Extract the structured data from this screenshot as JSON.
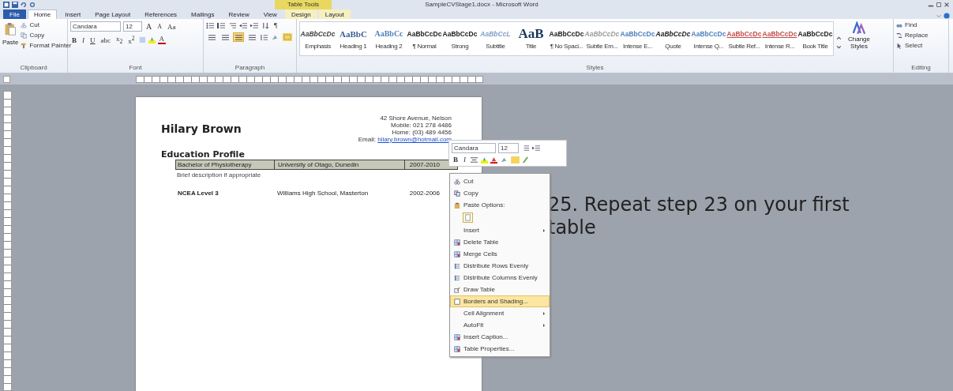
{
  "window": {
    "title": "SampleCVStage1.docx - Microsoft Word",
    "contextual_group": "Table Tools"
  },
  "tabs": [
    {
      "label": "File",
      "kind": "file",
      "selected": false
    },
    {
      "label": "Home",
      "kind": "tab",
      "selected": true
    },
    {
      "label": "Insert",
      "kind": "tab",
      "selected": false
    },
    {
      "label": "Page Layout",
      "kind": "tab",
      "selected": false
    },
    {
      "label": "References",
      "kind": "tab",
      "selected": false
    },
    {
      "label": "Mailings",
      "kind": "tab",
      "selected": false
    },
    {
      "label": "Review",
      "kind": "tab",
      "selected": false
    },
    {
      "label": "View",
      "kind": "tab",
      "selected": false
    },
    {
      "label": "Design",
      "kind": "contextual",
      "selected": false
    },
    {
      "label": "Layout",
      "kind": "contextual",
      "selected": false
    }
  ],
  "clipboard": {
    "paste": "Paste",
    "cut": "Cut",
    "copy": "Copy",
    "format_painter": "Format Painter",
    "group_label": "Clipboard"
  },
  "font": {
    "name": "Candara",
    "size": "12",
    "group_label": "Font",
    "row1": [
      {
        "label": "A",
        "kind": "grow"
      },
      {
        "label": "A",
        "kind": "shrink"
      },
      {
        "label": "Aa",
        "kind": "case"
      }
    ],
    "row2": [
      {
        "label": "B",
        "kind": "bold"
      },
      {
        "label": "I",
        "kind": "italic"
      },
      {
        "label": "U",
        "kind": "underline"
      },
      {
        "label": "abc",
        "kind": "strike"
      },
      {
        "label": "x$_{2}$",
        "kind": "plain"
      },
      {
        "label": "x$^{2}$",
        "kind": "plain"
      }
    ],
    "color_label": "A"
  },
  "paragraph": {
    "group_label": "Paragraph",
    "pilcrow": "¶",
    "alignments": [
      {
        "selected": false
      },
      {
        "selected": false
      },
      {
        "selected": true
      },
      {
        "selected": false
      }
    ]
  },
  "styles": {
    "group_label": "Styles",
    "items": [
      {
        "preview": "AaBbCcDc",
        "name": "Emphasis",
        "kind": "italic",
        "color": "#404040"
      },
      {
        "preview": "AaBbC",
        "name": "Heading 1",
        "kind": "heading",
        "color": "#365f91"
      },
      {
        "preview": "AaBbCc",
        "name": "Heading 2",
        "kind": "heading2",
        "color": "#4f81bd"
      },
      {
        "preview": "AaBbCcDc",
        "name": "¶ Normal",
        "kind": "normal",
        "color": "#202020"
      },
      {
        "preview": "AaBbCcDc",
        "name": "Strong",
        "kind": "bold",
        "color": "#202020"
      },
      {
        "preview": "AaBbCcL",
        "name": "Subtitle",
        "kind": "italic",
        "color": "#7f9fc8"
      },
      {
        "preview": "AaB",
        "name": "Title",
        "kind": "title",
        "color": "#17365d"
      },
      {
        "preview": "AaBbCcDc",
        "name": "¶ No Spaci...",
        "kind": "normal",
        "color": "#202020"
      },
      {
        "preview": "AaBbCcDc",
        "name": "Subtle Em...",
        "kind": "italic",
        "color": "#9a9a9a"
      },
      {
        "preview": "AaBbCcDc",
        "name": "Intense E...",
        "kind": "bold",
        "color": "#4f81bd"
      },
      {
        "preview": "AaBbCcDc",
        "name": "Quote",
        "kind": "italic",
        "color": "#202020"
      },
      {
        "preview": "AaBbCcDc",
        "name": "Intense Q...",
        "kind": "bold",
        "color": "#4f81bd"
      },
      {
        "preview": "AaBbCcDc",
        "name": "Subtle Ref...",
        "kind": "underline",
        "color": "#c0504d"
      },
      {
        "preview": "AaBbCcDc",
        "name": "Intense R...",
        "kind": "underline",
        "color": "#c0504d"
      },
      {
        "preview": "AaBbCcDc",
        "name": "Book Title",
        "kind": "bold",
        "color": "#202020"
      }
    ]
  },
  "change_styles": "Change Styles",
  "editing": {
    "find": "Find",
    "replace": "Replace",
    "select": "Select",
    "group_label": "Editing"
  },
  "document": {
    "name": "Hilary Brown",
    "contact": [
      "42 Shore Avenue, Nelson",
      "Mobile: 021 278 4486",
      "Home: (03) 489 4456"
    ],
    "email_label": "Email:",
    "email": "hilary.brown@hotmail.com",
    "section": "Education Profile",
    "rows": [
      {
        "cells": [
          "Bachelor of Physiotherapy",
          "University of Otago, Dunedin",
          "2007-2010"
        ],
        "selected": true,
        "note": "Brief description if appropriate"
      },
      {
        "cells": [
          "NCEA Level 3",
          "Williams High School, Masterton",
          "2002-2006"
        ],
        "selected": false
      }
    ]
  },
  "mini_toolbar": {
    "font": "Candara",
    "size": "12",
    "bold": "B",
    "italic": "I"
  },
  "context_menu": [
    {
      "label": "Cut",
      "kind": "cut",
      "submenu": false,
      "selected": false
    },
    {
      "label": "Copy",
      "kind": "copy",
      "submenu": false,
      "selected": false
    },
    {
      "label": "Paste Options:",
      "kind": "paste_header",
      "submenu": false,
      "selected": false
    },
    {
      "kind": "paste_button"
    },
    {
      "label": "Insert",
      "kind": "plain",
      "submenu": true,
      "selected": false
    },
    {
      "label": "Delete Table",
      "kind": "table",
      "submenu": false,
      "selected": false
    },
    {
      "label": "Merge Cells",
      "kind": "table",
      "submenu": false,
      "selected": false
    },
    {
      "label": "Distribute Rows Evenly",
      "kind": "lines",
      "submenu": false,
      "selected": false
    },
    {
      "label": "Distribute Columns Evenly",
      "kind": "lines",
      "submenu": false,
      "selected": false
    },
    {
      "label": "Draw Table",
      "kind": "pencil",
      "submenu": false,
      "selected": false
    },
    {
      "label": "Borders and Shading...",
      "kind": "border",
      "submenu": false,
      "selected": true
    },
    {
      "label": "Cell Alignment",
      "kind": "plain",
      "submenu": true,
      "selected": false
    },
    {
      "label": "AutoFit",
      "kind": "plain",
      "submenu": true,
      "selected": false
    },
    {
      "label": "Insert Caption...",
      "kind": "table",
      "submenu": false,
      "selected": false
    },
    {
      "label": "Table Properties...",
      "kind": "table",
      "submenu": false,
      "selected": false
    }
  ],
  "instruction": "25. Repeat step 23 on your first table"
}
